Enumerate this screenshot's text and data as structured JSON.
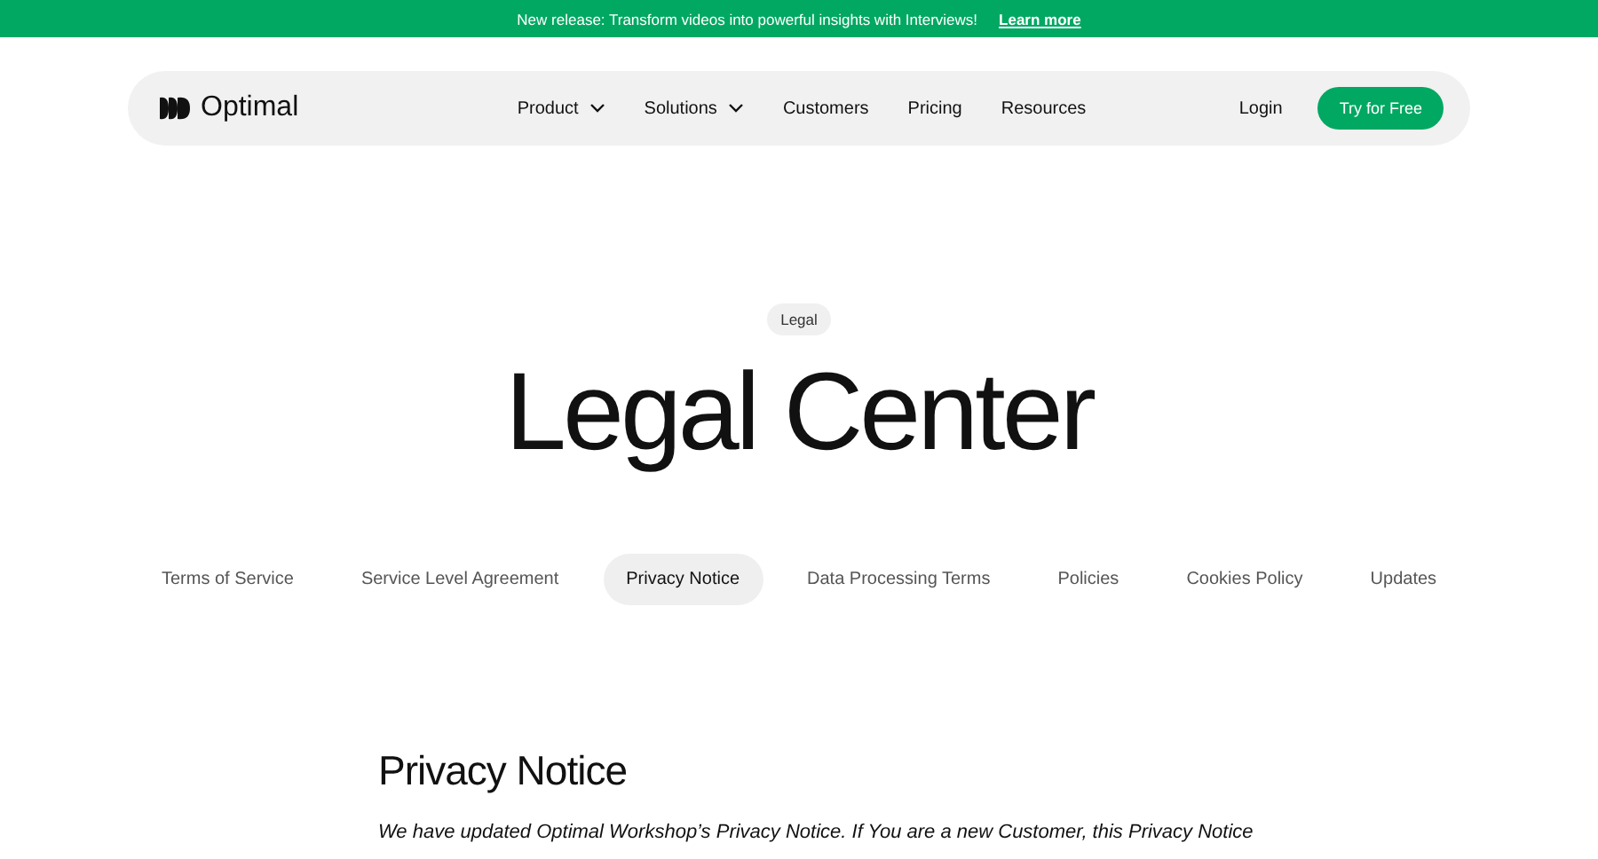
{
  "announcement": {
    "text": "New release: Transform videos into powerful insights with Interviews!",
    "link": "Learn more"
  },
  "nav": {
    "brand": "Optimal",
    "items": [
      {
        "label": "Product",
        "has_menu": true
      },
      {
        "label": "Solutions",
        "has_menu": true
      },
      {
        "label": "Customers",
        "has_menu": false
      },
      {
        "label": "Pricing",
        "has_menu": false
      },
      {
        "label": "Resources",
        "has_menu": false
      }
    ],
    "login": "Login",
    "cta": "Try for Free"
  },
  "hero": {
    "badge": "Legal",
    "title": "Legal Center"
  },
  "tabs": [
    {
      "label": "Terms of Service",
      "selected": false
    },
    {
      "label": "Service Level Agreement",
      "selected": false
    },
    {
      "label": "Privacy Notice",
      "selected": true
    },
    {
      "label": "Data Processing Terms",
      "selected": false
    },
    {
      "label": "Policies",
      "selected": false
    },
    {
      "label": "Cookies Policy",
      "selected": false
    },
    {
      "label": "Updates",
      "selected": false
    }
  ],
  "content": {
    "heading": "Privacy Notice",
    "intro": "We have updated Optimal Workshop’s Privacy Notice. If You are a new Customer, this Privacy Notice"
  }
}
